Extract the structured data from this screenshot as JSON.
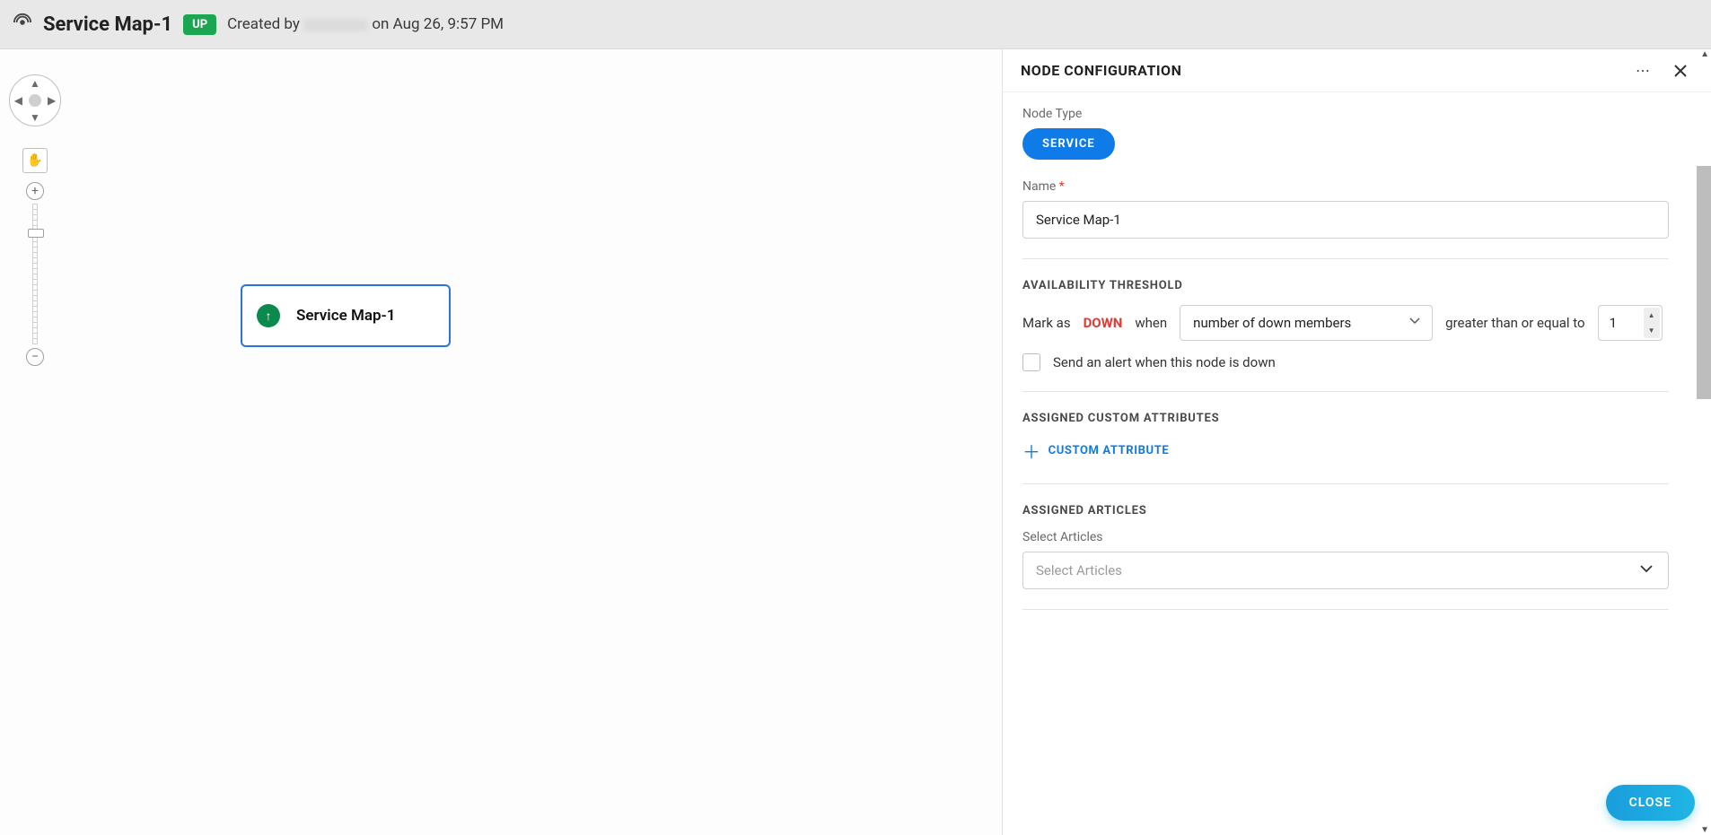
{
  "header": {
    "title": "Service Map-1",
    "status_badge": "UP",
    "created_prefix": "Created by",
    "created_suffix": "on Aug 26, 9:57 PM"
  },
  "node": {
    "label": "Service Map-1",
    "status_arrow": "↑"
  },
  "panel": {
    "title": "NODE CONFIGURATION",
    "close_label": "CLOSE",
    "node_type_label": "Node Type",
    "node_type_value": "SERVICE",
    "name_label": "Name",
    "name_value": "Service Map-1",
    "availability": {
      "section_title": "AVAILABILITY THRESHOLD",
      "mark_as": "Mark as",
      "down_word": "DOWN",
      "when_word": "when",
      "dropdown_value": "number of down members",
      "gte_text": "greater than or equal to",
      "number_value": "1",
      "alert_checkbox_label": "Send an alert when this node is down"
    },
    "custom_attr": {
      "section_title": "ASSIGNED CUSTOM ATTRIBUTES",
      "add_label": "CUSTOM ATTRIBUTE"
    },
    "articles": {
      "section_title": "ASSIGNED ARTICLES",
      "field_label": "Select Articles",
      "placeholder": "Select Articles"
    }
  }
}
